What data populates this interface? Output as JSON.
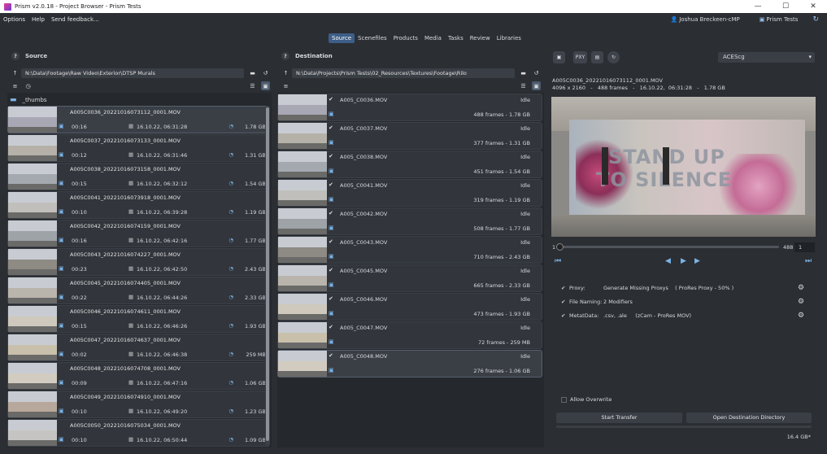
{
  "window": {
    "title": "Prism v2.0.18 - Project Browser - Prism Tests",
    "minimize": "—",
    "maximize": "☐",
    "close": "✕"
  },
  "menu": {
    "items": [
      "Options",
      "Help",
      "Send feedback..."
    ],
    "user": "Joshua Breckeen-cMP",
    "project": "Prism Tests"
  },
  "tabs": [
    "Source",
    "Scenefiles",
    "Products",
    "Media",
    "Tasks",
    "Review",
    "Libraries"
  ],
  "source": {
    "header": "Source",
    "path": "N:\\Data\\Footage\\Raw Video\\Exterior\\DTSP Murals",
    "folder": "_thumbs",
    "rows": [
      {
        "name": "A005C0036_20221016073112_0001.MOV",
        "duration": "00:16",
        "date": "16.10.22,  06:31:28",
        "size": "1.78 GB"
      },
      {
        "name": "A005C0037_20221016073133_0001.MOV",
        "duration": "00:12",
        "date": "16.10.22,  06:31:46",
        "size": "1.31 GB"
      },
      {
        "name": "A005C0038_20221016073158_0001.MOV",
        "duration": "00:15",
        "date": "16.10.22,  06:32:12",
        "size": "1.54 GB"
      },
      {
        "name": "A005C0041_20221016073918_0001.MOV",
        "duration": "00:10",
        "date": "16.10.22,  06:39:28",
        "size": "1.19 GB"
      },
      {
        "name": "A005C0042_20221016074159_0001.MOV",
        "duration": "00:16",
        "date": "16.10.22,  06:42:16",
        "size": "1.77 GB"
      },
      {
        "name": "A005C0043_20221016074227_0001.MOV",
        "duration": "00:23",
        "date": "16.10.22,  06:42:50",
        "size": "2.43 GB"
      },
      {
        "name": "A005C0045_20221016074405_0001.MOV",
        "duration": "00:22",
        "date": "16.10.22,  06:44:26",
        "size": "2.33 GB"
      },
      {
        "name": "A005C0046_20221016074611_0001.MOV",
        "duration": "00:15",
        "date": "16.10.22,  06:46:26",
        "size": "1.93 GB"
      },
      {
        "name": "A005C0047_20221016074637_0001.MOV",
        "duration": "00:02",
        "date": "16.10.22,  06:46:38",
        "size": "259 MB"
      },
      {
        "name": "A005C0048_20221016074708_0001.MOV",
        "duration": "00:09",
        "date": "16.10.22,  06:47:16",
        "size": "1.06 GB"
      },
      {
        "name": "A005C0049_20221016074910_0001.MOV",
        "duration": "00:10",
        "date": "16.10.22,  06:49:20",
        "size": "1.23 GB"
      },
      {
        "name": "A005C0050_20221016075034_0001.MOV",
        "duration": "00:10",
        "date": "16.10.22,  06:50:44",
        "size": "1.09 GB"
      }
    ]
  },
  "destination": {
    "header": "Destination",
    "path": "N:\\Data\\Projects\\Prism Tests\\02_Resources\\Textures\\Footage\\Rilo",
    "rows": [
      {
        "name": "A005_C0036.MOV",
        "status": "Idle",
        "info": "488 frames  -  1.78 GB"
      },
      {
        "name": "A005_C0037.MOV",
        "status": "Idle",
        "info": "377 frames  -  1.31 GB"
      },
      {
        "name": "A005_C0038.MOV",
        "status": "Idle",
        "info": "451 frames  -  1.54 GB"
      },
      {
        "name": "A005_C0041.MOV",
        "status": "Idle",
        "info": "319 frames  -  1.19 GB"
      },
      {
        "name": "A005_C0042.MOV",
        "status": "Idle",
        "info": "508 frames  -  1.77 GB"
      },
      {
        "name": "A005_C0043.MOV",
        "status": "Idle",
        "info": "710 frames  -  2.43 GB"
      },
      {
        "name": "A005_C0045.MOV",
        "status": "Idle",
        "info": "665 frames  -  2.33 GB"
      },
      {
        "name": "A005_C0046.MOV",
        "status": "Idle",
        "info": "473 frames  -  1.93 GB"
      },
      {
        "name": "A005_C0047.MOV",
        "status": "Idle",
        "info": "72 frames  -  259 MB"
      },
      {
        "name": "A005_C0048.MOV",
        "status": "Idle",
        "info": "276 frames  -  1.06 GB"
      }
    ]
  },
  "preview": {
    "colorspace": "ACEScg",
    "filename": "A005C0036_20221016073112_0001.MOV",
    "meta": "4096 x 2160   -   488 frames   -   16.10.22,  06:31:28   -   1.78 GB",
    "mural_line1": "STAND UP",
    "mural_line2": "TO SILENCE",
    "frame_start": "1",
    "frame_end": "488",
    "frame_current": "1",
    "toolbar": {
      "monitor": "▣",
      "proxy": "PXY",
      "save": "▤",
      "refresh": "↻"
    }
  },
  "options": {
    "proxy_label": "Proxy:",
    "proxy_value": "Generate Missing Proxys    ( ProRes Proxy - 50% )",
    "naming_label": "File Naming:",
    "naming_value": "2 Modifiers",
    "metadata_label": "MetatData:",
    "metadata_value": ".csv, .ale     (zCam - ProRes MOV)"
  },
  "footer": {
    "allow_overwrite": "Allow Overwrite",
    "start_transfer": "Start Transfer",
    "open_dest": "Open Destination Directory",
    "total_size": "16.4 GB*"
  },
  "colors": {
    "accent": "#3d5e86",
    "bg": "#2b2e33",
    "row": "#32363c",
    "icon_blue": "#7ab3e8"
  }
}
